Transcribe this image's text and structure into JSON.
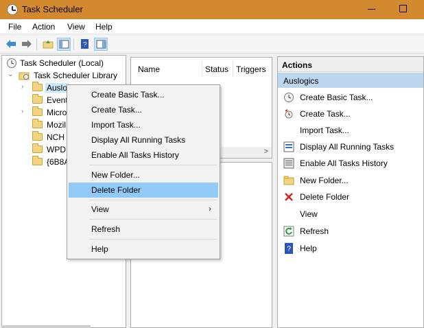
{
  "window": {
    "title": "Task Scheduler"
  },
  "menu": [
    "File",
    "Action",
    "View",
    "Help"
  ],
  "tree": {
    "root": "Task Scheduler (Local)",
    "library": "Task Scheduler Library",
    "folders": [
      "Auslo",
      "Event",
      "Micro",
      "Mozil",
      "NCH",
      "WPD",
      "{6B8A"
    ]
  },
  "list": {
    "columns": [
      "Name",
      "Status",
      "Triggers"
    ],
    "scroll_right": ">"
  },
  "actions": {
    "header": "Actions",
    "section": "Auslogics",
    "items": [
      {
        "label": "Create Basic Task...",
        "icon": "create-basic-task-icon"
      },
      {
        "label": "Create Task...",
        "icon": "create-task-icon"
      },
      {
        "label": "Import Task...",
        "icon": ""
      },
      {
        "label": "Display All Running Tasks",
        "icon": "running-tasks-icon"
      },
      {
        "label": "Enable All Tasks History",
        "icon": "history-icon"
      },
      {
        "label": "New Folder...",
        "icon": "folder-icon"
      },
      {
        "label": "Delete Folder",
        "icon": "delete-icon"
      },
      {
        "label": "View",
        "icon": ""
      },
      {
        "label": "Refresh",
        "icon": "refresh-icon"
      },
      {
        "label": "Help",
        "icon": "help-icon"
      }
    ]
  },
  "context_menu": {
    "items": [
      "Create Basic Task...",
      "Create Task...",
      "Import Task...",
      "Display All Running Tasks",
      "Enable All Tasks History",
      "New Folder...",
      "Delete Folder",
      "View",
      "Refresh",
      "Help"
    ],
    "highlighted": "Delete Folder",
    "submenu_arrow": "›"
  },
  "colors": {
    "titlebar": "#d38a2e",
    "selection": "#91c9f7",
    "actions_section": "#bcd6ee"
  }
}
